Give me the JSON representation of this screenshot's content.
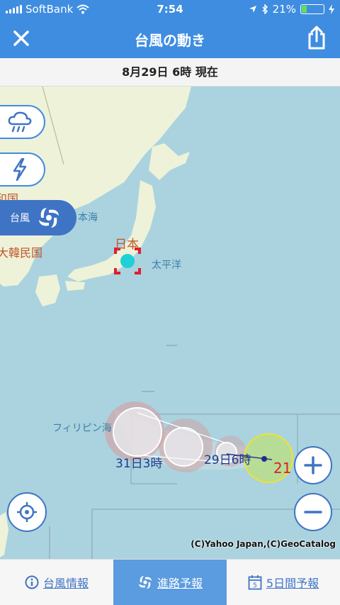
{
  "status_bar": {
    "carrier": "SoftBank",
    "time": "7:54",
    "battery": "21%"
  },
  "header": {
    "title": "台風の動き"
  },
  "date_bar": {
    "text": "8月29日 6時 現在"
  },
  "map": {
    "labels": {
      "japan": "日本",
      "sea_of_japan": "本海",
      "pacific": "太平洋",
      "korea": "大韓民国",
      "dprk": "朝鮮民主主義人民共和国",
      "philippine_sea": "フィリピン海"
    },
    "typhoon_toggle_label": "台風",
    "track_labels": {
      "day31": "31日3時",
      "day29": "29日6時"
    },
    "typhoon_number": "21",
    "copyright": "(C)Yahoo Japan,(C)GeoCatalog"
  },
  "tabs": [
    {
      "label": "台風情報",
      "icon": "info-icon"
    },
    {
      "label": "進路予報",
      "icon": "typhoon-icon"
    },
    {
      "label": "5日間予報",
      "icon": "calendar-icon",
      "icon_text": "5"
    }
  ]
}
